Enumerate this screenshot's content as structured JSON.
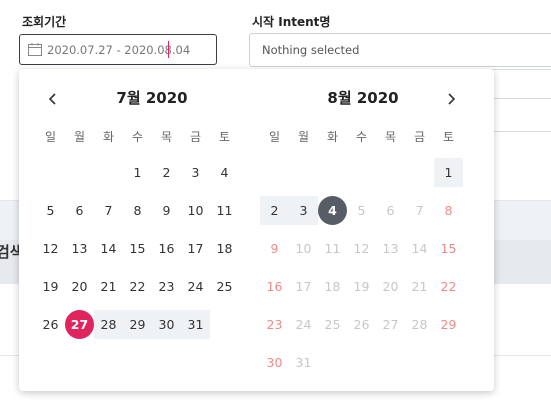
{
  "filters": {
    "period_label": "조회기간",
    "period_value": "2020.07.27 - 2020.08.04",
    "intent_label": "시작 Intent명",
    "intent_value": "Nothing selected"
  },
  "background": {
    "partial_heading": "검색"
  },
  "calendar": {
    "weekdays": [
      "일",
      "월",
      "화",
      "수",
      "목",
      "금",
      "토"
    ],
    "left_month": {
      "title": "7월 2020",
      "days": [
        [
          "",
          "",
          "",
          "1",
          "2",
          "3",
          "4"
        ],
        [
          "5",
          "6",
          "7",
          "8",
          "9",
          "10",
          "11"
        ],
        [
          "12",
          "13",
          "14",
          "15",
          "16",
          "17",
          "18"
        ],
        [
          "19",
          "20",
          "21",
          "22",
          "23",
          "24",
          "25"
        ],
        [
          "26",
          "27",
          "28",
          "29",
          "30",
          "31",
          ""
        ]
      ]
    },
    "right_month": {
      "title": "8월 2020",
      "days": [
        [
          "",
          "",
          "",
          "",
          "",
          "",
          "1"
        ],
        [
          "2",
          "3",
          "4",
          "5",
          "6",
          "7",
          "8"
        ],
        [
          "9",
          "10",
          "11",
          "12",
          "13",
          "14",
          "15"
        ],
        [
          "16",
          "17",
          "18",
          "19",
          "20",
          "21",
          "22"
        ],
        [
          "23",
          "24",
          "25",
          "26",
          "27",
          "28",
          "29"
        ],
        [
          "30",
          "31",
          "",
          "",
          "",
          "",
          ""
        ]
      ]
    },
    "range_start": "2020.07.27",
    "range_end": "2020.08.04"
  },
  "colors": {
    "start_day": "#e0245e",
    "end_day": "#565d66",
    "range_bg": "#eef2f5",
    "weekend_disabled": "#ef8a8a",
    "disabled": "#c4c7cb"
  }
}
